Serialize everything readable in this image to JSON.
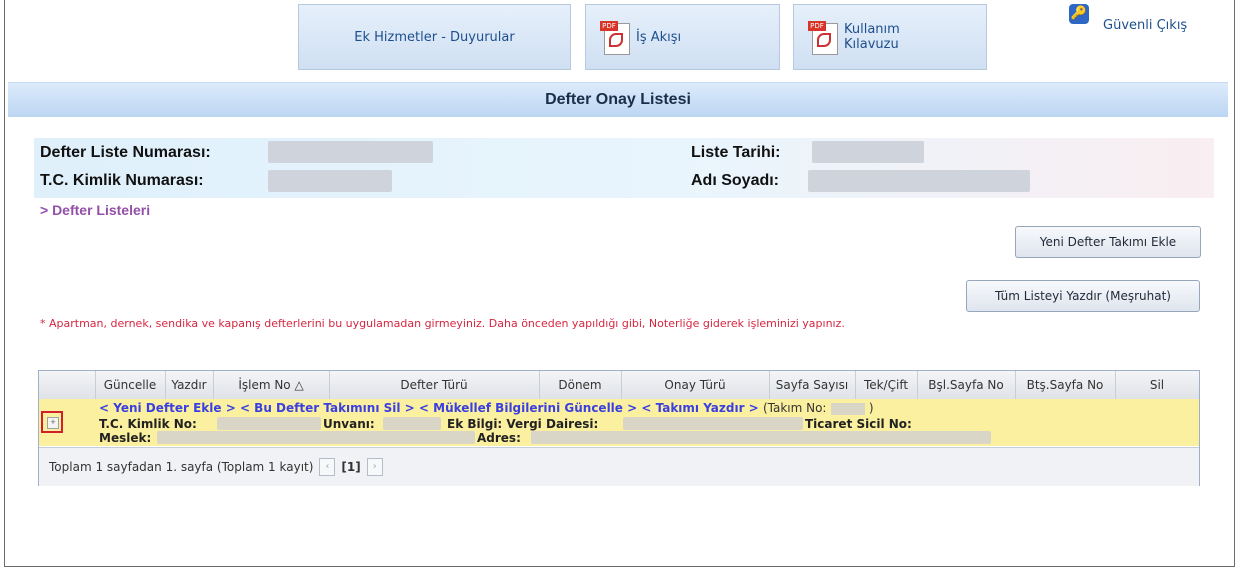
{
  "nav": {
    "ek_hizmetler": "Ek Hizmetler - Duyurular",
    "is_akisi": "İş Akışı",
    "kullanim_line1": "Kullanım",
    "kullanim_line2": "Kılavuzu",
    "guvenli_cikis": "Güvenli Çıkış",
    "pdf_tag": "PDF"
  },
  "title": "Defter Onay Listesi",
  "info": {
    "defter_liste_numarasi": "Defter Liste Numarası:",
    "tc_kimlik_numarasi": "T.C. Kimlik Numarası:",
    "liste_tarihi": "Liste Tarihi:",
    "adi_soyadi": "Adı Soyadı:"
  },
  "breadcrumb": "> Defter Listeleri",
  "buttons": {
    "yeni_defter": "Yeni Defter Takımı Ekle",
    "tum_listeyi_yazdir": "Tüm Listeyi Yazdır (Meşruhat)"
  },
  "warning": "* Apartman, dernek, sendika ve kapanış defterlerini bu uygulamadan girmeyiniz. Daha önceden yapıldığı gibi, Noterliğe giderek işleminizi yapınız.",
  "grid": {
    "columns": [
      "Güncelle",
      "Yazdır",
      "İşlem No △",
      "Defter Türü",
      "Dönem",
      "Onay Türü",
      "Sayfa Sayısı",
      "Tek/Çift",
      "Bşl.Sayfa No",
      "Btş.Sayfa No",
      "Sil"
    ],
    "row": {
      "link_yeni": "< Yeni Defter Ekle >",
      "link_sil": "< Bu Defter Takımını Sil >",
      "link_guncelle": "< Mükellef Bilgilerini Güncelle >",
      "link_yazdir": "< Takımı Yazdır >",
      "takim_open": "(Takım No:",
      "takim_close": ")",
      "tc_kimlik": "T.C. Kimlik No:",
      "unvani": "Unvanı:",
      "ek_bilgi": "Ek Bilgi: Vergi Dairesi:",
      "ticaret_sicil": "Ticaret Sicil No:",
      "meslek": "Meslek:",
      "adres": "Adres:"
    },
    "footer": {
      "summary": "Toplam 1 sayfadan 1. sayfa (Toplam 1 kayıt)",
      "page": "[1]"
    }
  }
}
